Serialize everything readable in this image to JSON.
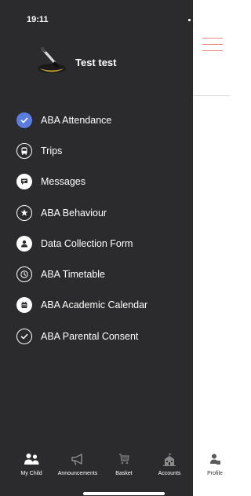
{
  "status_bar": {
    "time": "19:11"
  },
  "user": {
    "name": "Test test",
    "avatar_icon": "paintbrush-avatar-icon"
  },
  "menu": {
    "items": [
      {
        "label": "ABA Attendance",
        "icon": "check-circle-icon"
      },
      {
        "label": "Trips",
        "icon": "bus-icon"
      },
      {
        "label": "Messages",
        "icon": "chat-bubble-icon"
      },
      {
        "label": "ABA Behaviour",
        "icon": "star-hand-icon"
      },
      {
        "label": "Data Collection Form",
        "icon": "person-icon"
      },
      {
        "label": "ABA Timetable",
        "icon": "clock-icon"
      },
      {
        "label": "ABA Academic Calendar",
        "icon": "calendar-icon"
      },
      {
        "label": "ABA Parental Consent",
        "icon": "check-outline-icon"
      }
    ]
  },
  "bottom_nav": {
    "tabs": [
      {
        "label": "My Child",
        "icon": "people-icon"
      },
      {
        "label": "Announcements",
        "icon": "megaphone-icon"
      },
      {
        "label": "Basket",
        "icon": "cart-icon"
      },
      {
        "label": "Accounts",
        "icon": "school-building-icon"
      },
      {
        "label": "Profile",
        "icon": "profile-icon"
      }
    ]
  },
  "colors": {
    "drawer_background": "#2b2b2d",
    "accent_check": "#5b7de0",
    "hamburger": "#e8877f",
    "page_background": "#ffffff"
  }
}
